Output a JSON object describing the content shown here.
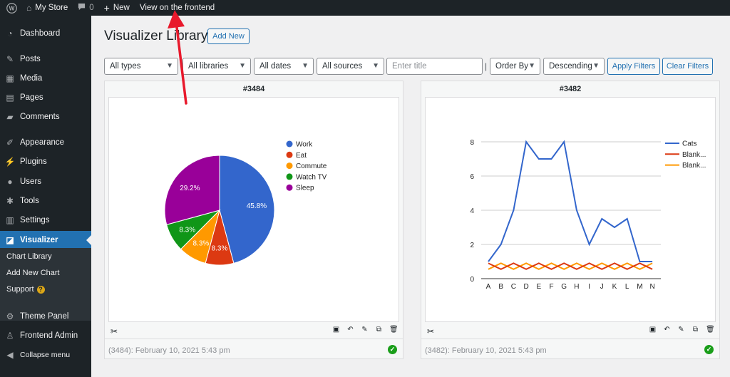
{
  "adminbar": {
    "site_name": "My Store",
    "comments_count": "0",
    "new_label": "New",
    "view_frontend_label": "View on the frontend"
  },
  "sidebar": {
    "items": [
      {
        "label": "Dashboard",
        "icon": "dashboard-icon"
      },
      {
        "label": "Posts",
        "icon": "pin-icon"
      },
      {
        "label": "Media",
        "icon": "media-icon"
      },
      {
        "label": "Pages",
        "icon": "pages-icon"
      },
      {
        "label": "Comments",
        "icon": "comment-icon"
      },
      {
        "label": "Appearance",
        "icon": "brush-icon"
      },
      {
        "label": "Plugins",
        "icon": "plug-icon"
      },
      {
        "label": "Users",
        "icon": "user-icon"
      },
      {
        "label": "Tools",
        "icon": "wrench-icon"
      },
      {
        "label": "Settings",
        "icon": "settings-icon"
      },
      {
        "label": "Visualizer",
        "icon": "chart-icon",
        "current": true
      }
    ],
    "submenu": [
      "Chart Library",
      "Add New Chart",
      "Support"
    ],
    "support_badge": "?",
    "bottom_items": [
      {
        "label": "Theme Panel",
        "icon": "gear-icon"
      },
      {
        "label": "Frontend Admin",
        "icon": "person-icon"
      },
      {
        "label": "Collapse menu",
        "icon": "collapse-icon"
      }
    ]
  },
  "main": {
    "title": "Visualizer Library",
    "add_new_label": "Add New",
    "filters": {
      "types": "All types",
      "libraries": "All libraries",
      "dates": "All dates",
      "sources": "All sources",
      "title_placeholder": "Enter title",
      "order_by": "Order By",
      "direction": "Descending",
      "apply_label": "Apply Filters",
      "clear_label": "Clear Filters"
    }
  },
  "cards": [
    {
      "title": "#3484",
      "meta": "(3484): February 10, 2021 5:43 pm"
    },
    {
      "title": "#3482",
      "meta": "(3482): February 10, 2021 5:43 pm"
    }
  ],
  "colors": {
    "accent": "#2271b1",
    "sidebar_bg": "#1d2327",
    "arrow": "#e8192c",
    "success": "#1a9e1a"
  },
  "chart_data": [
    {
      "type": "pie",
      "labels": [
        "Work",
        "Eat",
        "Commute",
        "Watch TV",
        "Sleep"
      ],
      "values": [
        45.8,
        8.3,
        8.3,
        8.3,
        29.2
      ],
      "slice_labels": [
        "45.8%",
        "8.3%",
        "8.3%",
        "8.3%",
        "29.2%"
      ],
      "colors": [
        "#3366cc",
        "#dc3912",
        "#ff9900",
        "#109618",
        "#990099"
      ],
      "legend": "right"
    },
    {
      "type": "line",
      "categories": [
        "A",
        "B",
        "C",
        "D",
        "E",
        "F",
        "G",
        "H",
        "I",
        "J",
        "K",
        "L",
        "M",
        "N"
      ],
      "series": [
        {
          "name": "Cats",
          "color": "#3366cc",
          "values": [
            1,
            2,
            4,
            8,
            7,
            7,
            8,
            4,
            2,
            3.5,
            3,
            3.5,
            1,
            1
          ]
        },
        {
          "name": "Blank...",
          "color": "#dc3912",
          "values": [
            0.9,
            0.55,
            0.9,
            0.55,
            0.9,
            0.55,
            0.9,
            0.55,
            0.9,
            0.55,
            0.9,
            0.55,
            0.9,
            0.55
          ]
        },
        {
          "name": "Blank...",
          "color": "#ff9900",
          "values": [
            0.55,
            0.9,
            0.55,
            0.9,
            0.55,
            0.9,
            0.55,
            0.9,
            0.55,
            0.9,
            0.55,
            0.9,
            0.55,
            0.9
          ]
        }
      ],
      "yticks": [
        0,
        2,
        4,
        6,
        8
      ],
      "ylim": [
        0,
        8
      ],
      "grid": true,
      "legend": "right"
    }
  ]
}
